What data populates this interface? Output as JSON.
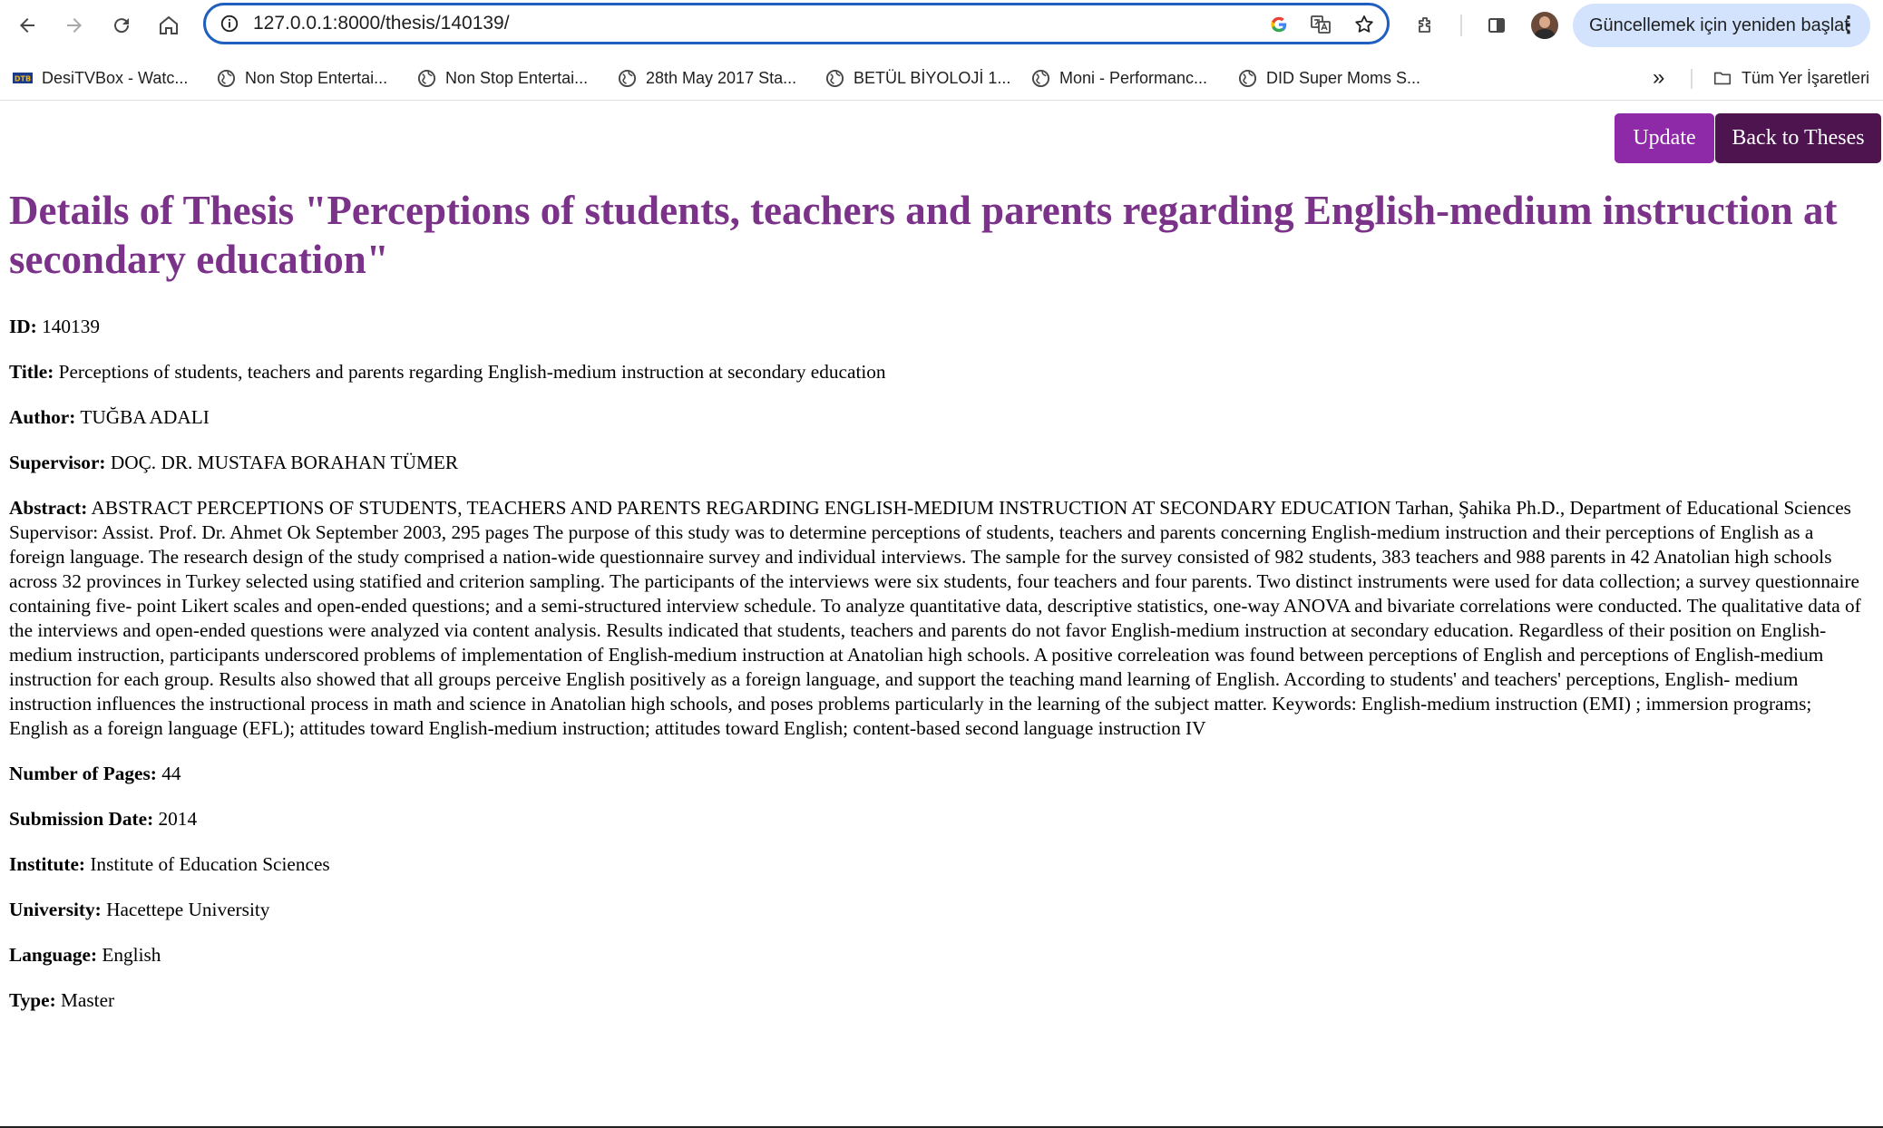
{
  "browser": {
    "url": "127.0.0.1:8000/thesis/140139/",
    "update_chip": "Güncellemek için yeniden başlat",
    "bookmarks": [
      "DesiTVBox - Watc...",
      "Non Stop Entertai...",
      "Non Stop Entertai...",
      "28th May 2017 Sta...",
      "BETÜL BİYOLOJİ 1...",
      "Moni - Performanc...",
      "DID Super Moms S..."
    ],
    "all_bookmarks": "Tüm Yer İşaretleri"
  },
  "page": {
    "buttons": {
      "update": "Update",
      "back": "Back to Theses"
    },
    "heading": "Details of Thesis \"Perceptions of students, teachers and parents regarding English-medium instruction at secondary education\"",
    "fields": [
      {
        "label": "ID:",
        "value": "140139"
      },
      {
        "label": "Title:",
        "value": "Perceptions of students, teachers and parents regarding English-medium instruction at secondary education"
      },
      {
        "label": "Author:",
        "value": "TUĞBA ADALI"
      },
      {
        "label": "Supervisor:",
        "value": "DOÇ. DR. MUSTAFA BORAHAN TÜMER"
      },
      {
        "label": "Abstract:",
        "value": "ABSTRACT PERCEPTIONS OF STUDENTS, TEACHERS AND PARENTS REGARDING ENGLISH-MEDIUM INSTRUCTION AT SECONDARY EDUCATION Tarhan, Şahika Ph.D., Department of Educational Sciences Supervisor: Assist. Prof. Dr. Ahmet Ok September 2003, 295 pages The purpose of this study was to determine perceptions of students, teachers and parents concerning English-medium instruction and their perceptions of English as a foreign language. The research design of the study comprised a nation-wide questionnaire survey and individual interviews. The sample for the survey consisted of 982 students, 383 teachers and 988 parents in 42 Anatolian high schools across 32 provinces in Turkey selected using statified and criterion sampling. The participants of the interviews were six students, four teachers and four parents. Two distinct instruments were used for data collection; a survey questionnaire containing five- point Likert scales and open-ended questions; and a semi-structured interview schedule. To analyze quantitative data, descriptive statistics, one-way ANOVA and bivariate correlations were conducted. The qualitative data of the interviews and open-ended questions were analyzed via content analysis. Results indicated that students, teachers and parents do not favor English-medium instruction at secondary education. Regardless of their position on English-medium instruction, participants underscored problems of implementation of English-medium instruction at Anatolian high schools. A positive correleation was found between perceptions of English and perceptions of English-medium instruction for each group. Results also showed that all groups perceive English positively as a foreign language, and support the teaching mand learning of English. According to students' and teachers' perceptions, English- medium instruction influences the instructional process in math and science in Anatolian high schools, and poses problems particularly in the learning of the subject matter. Keywords: English-medium instruction (EMI) ; immersion programs; English as a foreign language (EFL); attitudes toward English-medium instruction; attitudes toward English; content-based second language instruction IV"
      },
      {
        "label": "Number of Pages:",
        "value": "44"
      },
      {
        "label": "Submission Date:",
        "value": "2014"
      },
      {
        "label": "Institute:",
        "value": "Institute of Education Sciences"
      },
      {
        "label": "University:",
        "value": "Hacettepe University"
      },
      {
        "label": "Language:",
        "value": "English"
      },
      {
        "label": "Type:",
        "value": "Master"
      }
    ]
  },
  "colors": {
    "heading": "#7b3289",
    "update_button": "#8e2aa8",
    "back_button": "#4d1450",
    "omnibox_border": "#1f5fbf",
    "update_chip": "#d3e3fd"
  },
  "icons": {
    "nav": [
      "back-arrow-icon",
      "forward-arrow-icon",
      "reload-icon",
      "home-icon"
    ],
    "omnibox": [
      "site-info-icon",
      "google-icon",
      "translate-icon",
      "bookmark-star-icon"
    ],
    "toolbar": [
      "extensions-icon",
      "side-panel-icon",
      "profile-avatar",
      "menu-dots-icon"
    ],
    "bookmarks": [
      "desitvbox-favicon",
      "globe-icon",
      "chevron-double-right-icon",
      "folder-icon"
    ]
  }
}
